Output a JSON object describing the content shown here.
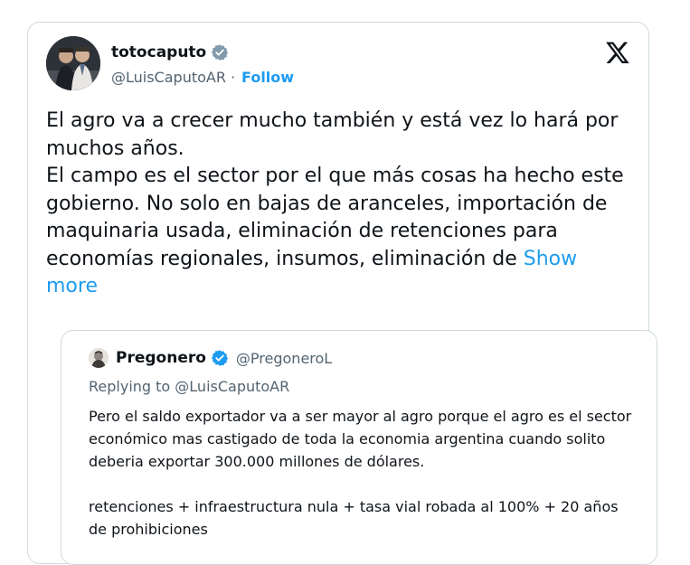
{
  "tweet": {
    "display_name": "totocaputo",
    "handle": "@LuisCaputoAR",
    "separator": "·",
    "follow_label": "Follow",
    "text_paragraphs": [
      "El agro va a crecer mucho también y está vez lo hará por muchos años.",
      "El campo es el sector por el que más cosas ha hecho este gobierno. No solo en bajas de aranceles, importación de maquinaria usada, eliminación de retenciones para economías regionales, insumos, eliminación de"
    ],
    "show_more_label": "Show more",
    "icons": {
      "avatar": "avatar-photo",
      "verified": "verified-badge-icon",
      "platform": "x-logo-icon"
    }
  },
  "quote": {
    "display_name": "Pregonero",
    "handle": "@PregoneroL",
    "replying_to": "Replying to @LuisCaputoAR",
    "body_paragraphs": [
      "Pero el saldo exportador va a ser mayor al agro porque el agro es el sector económico mas castigado de toda la economia argentina cuando solito deberia exportar 300.000 millones de dólares.",
      "retenciones + infraestructura nula + tasa vial robada al 100% + 20 años de prohibiciones"
    ]
  },
  "colors": {
    "accent": "#1d9bf0",
    "secondary_text": "#536471",
    "primary_text": "#0f1419",
    "border": "#cfd9de"
  }
}
